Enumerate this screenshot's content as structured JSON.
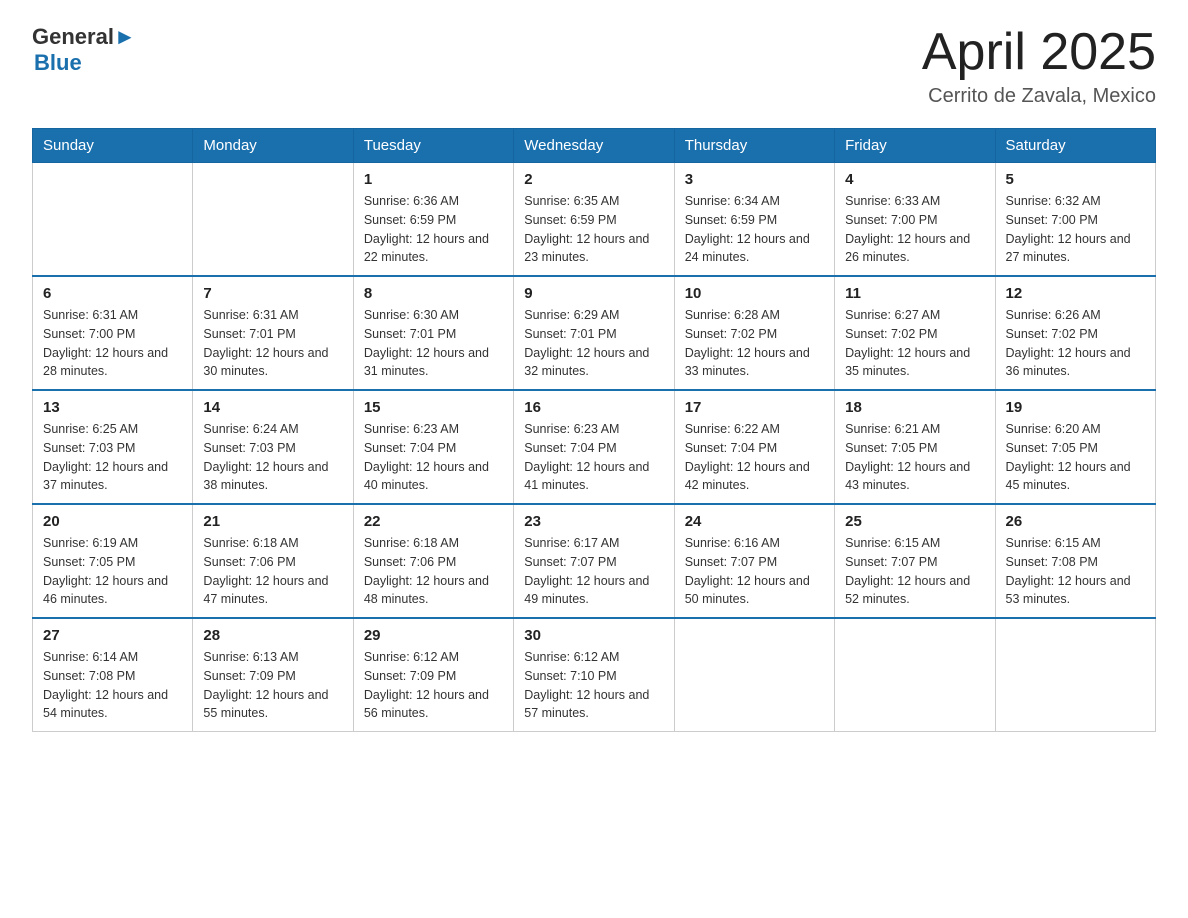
{
  "header": {
    "logo": {
      "general": "General",
      "blue": "Blue"
    },
    "title": "April 2025",
    "subtitle": "Cerrito de Zavala, Mexico"
  },
  "weekdays": [
    "Sunday",
    "Monday",
    "Tuesday",
    "Wednesday",
    "Thursday",
    "Friday",
    "Saturday"
  ],
  "weeks": [
    [
      {
        "day": "",
        "info": ""
      },
      {
        "day": "",
        "info": ""
      },
      {
        "day": "1",
        "info": "Sunrise: 6:36 AM\nSunset: 6:59 PM\nDaylight: 12 hours\nand 22 minutes."
      },
      {
        "day": "2",
        "info": "Sunrise: 6:35 AM\nSunset: 6:59 PM\nDaylight: 12 hours\nand 23 minutes."
      },
      {
        "day": "3",
        "info": "Sunrise: 6:34 AM\nSunset: 6:59 PM\nDaylight: 12 hours\nand 24 minutes."
      },
      {
        "day": "4",
        "info": "Sunrise: 6:33 AM\nSunset: 7:00 PM\nDaylight: 12 hours\nand 26 minutes."
      },
      {
        "day": "5",
        "info": "Sunrise: 6:32 AM\nSunset: 7:00 PM\nDaylight: 12 hours\nand 27 minutes."
      }
    ],
    [
      {
        "day": "6",
        "info": "Sunrise: 6:31 AM\nSunset: 7:00 PM\nDaylight: 12 hours\nand 28 minutes."
      },
      {
        "day": "7",
        "info": "Sunrise: 6:31 AM\nSunset: 7:01 PM\nDaylight: 12 hours\nand 30 minutes."
      },
      {
        "day": "8",
        "info": "Sunrise: 6:30 AM\nSunset: 7:01 PM\nDaylight: 12 hours\nand 31 minutes."
      },
      {
        "day": "9",
        "info": "Sunrise: 6:29 AM\nSunset: 7:01 PM\nDaylight: 12 hours\nand 32 minutes."
      },
      {
        "day": "10",
        "info": "Sunrise: 6:28 AM\nSunset: 7:02 PM\nDaylight: 12 hours\nand 33 minutes."
      },
      {
        "day": "11",
        "info": "Sunrise: 6:27 AM\nSunset: 7:02 PM\nDaylight: 12 hours\nand 35 minutes."
      },
      {
        "day": "12",
        "info": "Sunrise: 6:26 AM\nSunset: 7:02 PM\nDaylight: 12 hours\nand 36 minutes."
      }
    ],
    [
      {
        "day": "13",
        "info": "Sunrise: 6:25 AM\nSunset: 7:03 PM\nDaylight: 12 hours\nand 37 minutes."
      },
      {
        "day": "14",
        "info": "Sunrise: 6:24 AM\nSunset: 7:03 PM\nDaylight: 12 hours\nand 38 minutes."
      },
      {
        "day": "15",
        "info": "Sunrise: 6:23 AM\nSunset: 7:04 PM\nDaylight: 12 hours\nand 40 minutes."
      },
      {
        "day": "16",
        "info": "Sunrise: 6:23 AM\nSunset: 7:04 PM\nDaylight: 12 hours\nand 41 minutes."
      },
      {
        "day": "17",
        "info": "Sunrise: 6:22 AM\nSunset: 7:04 PM\nDaylight: 12 hours\nand 42 minutes."
      },
      {
        "day": "18",
        "info": "Sunrise: 6:21 AM\nSunset: 7:05 PM\nDaylight: 12 hours\nand 43 minutes."
      },
      {
        "day": "19",
        "info": "Sunrise: 6:20 AM\nSunset: 7:05 PM\nDaylight: 12 hours\nand 45 minutes."
      }
    ],
    [
      {
        "day": "20",
        "info": "Sunrise: 6:19 AM\nSunset: 7:05 PM\nDaylight: 12 hours\nand 46 minutes."
      },
      {
        "day": "21",
        "info": "Sunrise: 6:18 AM\nSunset: 7:06 PM\nDaylight: 12 hours\nand 47 minutes."
      },
      {
        "day": "22",
        "info": "Sunrise: 6:18 AM\nSunset: 7:06 PM\nDaylight: 12 hours\nand 48 minutes."
      },
      {
        "day": "23",
        "info": "Sunrise: 6:17 AM\nSunset: 7:07 PM\nDaylight: 12 hours\nand 49 minutes."
      },
      {
        "day": "24",
        "info": "Sunrise: 6:16 AM\nSunset: 7:07 PM\nDaylight: 12 hours\nand 50 minutes."
      },
      {
        "day": "25",
        "info": "Sunrise: 6:15 AM\nSunset: 7:07 PM\nDaylight: 12 hours\nand 52 minutes."
      },
      {
        "day": "26",
        "info": "Sunrise: 6:15 AM\nSunset: 7:08 PM\nDaylight: 12 hours\nand 53 minutes."
      }
    ],
    [
      {
        "day": "27",
        "info": "Sunrise: 6:14 AM\nSunset: 7:08 PM\nDaylight: 12 hours\nand 54 minutes."
      },
      {
        "day": "28",
        "info": "Sunrise: 6:13 AM\nSunset: 7:09 PM\nDaylight: 12 hours\nand 55 minutes."
      },
      {
        "day": "29",
        "info": "Sunrise: 6:12 AM\nSunset: 7:09 PM\nDaylight: 12 hours\nand 56 minutes."
      },
      {
        "day": "30",
        "info": "Sunrise: 6:12 AM\nSunset: 7:10 PM\nDaylight: 12 hours\nand 57 minutes."
      },
      {
        "day": "",
        "info": ""
      },
      {
        "day": "",
        "info": ""
      },
      {
        "day": "",
        "info": ""
      }
    ]
  ]
}
